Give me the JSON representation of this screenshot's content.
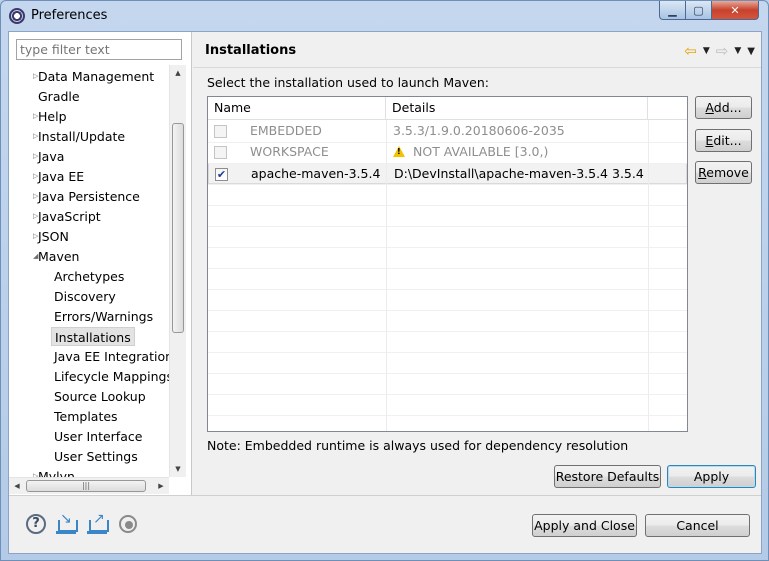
{
  "window": {
    "title": "Preferences"
  },
  "filter": {
    "placeholder": "type filter text"
  },
  "tree": {
    "items": [
      {
        "label": "Data Management",
        "expandable": true,
        "level": 0
      },
      {
        "label": "Gradle",
        "expandable": false,
        "level": 0
      },
      {
        "label": "Help",
        "expandable": true,
        "level": 0
      },
      {
        "label": "Install/Update",
        "expandable": true,
        "level": 0
      },
      {
        "label": "Java",
        "expandable": true,
        "level": 0
      },
      {
        "label": "Java EE",
        "expandable": true,
        "level": 0
      },
      {
        "label": "Java Persistence",
        "expandable": true,
        "level": 0
      },
      {
        "label": "JavaScript",
        "expandable": true,
        "level": 0
      },
      {
        "label": "JSON",
        "expandable": true,
        "level": 0
      },
      {
        "label": "Maven",
        "expandable": true,
        "expanded": true,
        "level": 0
      },
      {
        "label": "Archetypes",
        "level": 1
      },
      {
        "label": "Discovery",
        "level": 1
      },
      {
        "label": "Errors/Warnings",
        "level": 1
      },
      {
        "label": "Installations",
        "level": 1,
        "selected": true
      },
      {
        "label": "Java EE Integration",
        "level": 1
      },
      {
        "label": "Lifecycle Mappings",
        "level": 1
      },
      {
        "label": "Source Lookup",
        "level": 1
      },
      {
        "label": "Templates",
        "level": 1
      },
      {
        "label": "User Interface",
        "level": 1
      },
      {
        "label": "User Settings",
        "level": 1
      },
      {
        "label": "Mylyn",
        "expandable": true,
        "level": 0
      }
    ]
  },
  "page": {
    "title": "Installations",
    "instruction": "Select the installation used to launch Maven:",
    "note": "Note: Embedded runtime is always used for dependency resolution"
  },
  "table": {
    "columns": [
      "Name",
      "Details"
    ],
    "rows": [
      {
        "name": "EMBEDDED",
        "details": "3.5.3/1.9.0.20180606-2035",
        "checked": false,
        "disabled": true,
        "warning": false
      },
      {
        "name": "WORKSPACE",
        "details": "NOT AVAILABLE [3.0,)",
        "checked": false,
        "disabled": true,
        "warning": true
      },
      {
        "name": "apache-maven-3.5.4",
        "details": "D:\\DevInstall\\apache-maven-3.5.4 3.5.4",
        "checked": true,
        "disabled": false,
        "warning": false
      }
    ]
  },
  "buttons": {
    "add": "Add...",
    "edit": "Edit...",
    "remove": "Remove",
    "restore_defaults": "Restore Defaults",
    "apply": "Apply",
    "apply_close": "Apply and Close",
    "cancel": "Cancel"
  },
  "icons": {
    "help": "help-icon",
    "import": "import-icon",
    "export": "export-icon",
    "record": "record-icon"
  },
  "colors": {
    "accent": "#3c7fb1",
    "warning": "#f2c200",
    "nav_back": "#e3a400"
  }
}
